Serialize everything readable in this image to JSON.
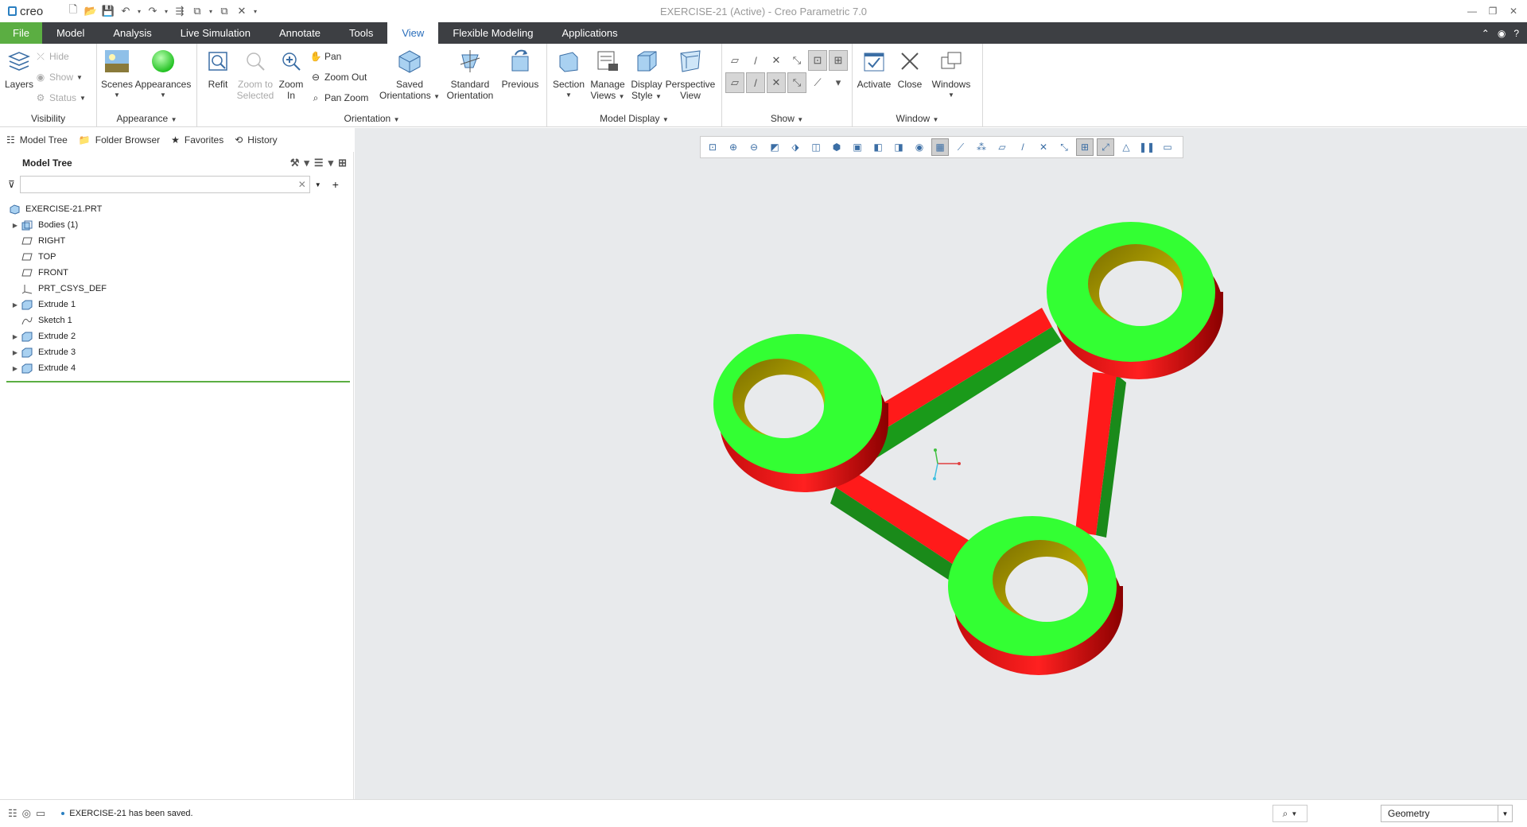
{
  "app": {
    "brand": "creo",
    "window_title": "EXERCISE-21 (Active) - Creo Parametric 7.0"
  },
  "tabs": [
    {
      "label": "File"
    },
    {
      "label": "Model"
    },
    {
      "label": "Analysis"
    },
    {
      "label": "Live Simulation"
    },
    {
      "label": "Annotate"
    },
    {
      "label": "Tools"
    },
    {
      "label": "View"
    },
    {
      "label": "Flexible Modeling"
    },
    {
      "label": "Applications"
    }
  ],
  "ribbon": {
    "visibility": {
      "label": "Visibility",
      "layers": "Layers",
      "hide": "Hide",
      "show": "Show",
      "status": "Status"
    },
    "appearance": {
      "label": "Appearance",
      "scenes": "Scenes",
      "appearances": "Appearances"
    },
    "orientation": {
      "label": "Orientation",
      "refit": "Refit",
      "zoom_to_selected_1": "Zoom to",
      "zoom_to_selected_2": "Selected",
      "zoom_in_1": "Zoom",
      "zoom_in_2": "In",
      "pan": "Pan",
      "zoom_out": "Zoom Out",
      "pan_zoom": "Pan Zoom",
      "saved_1": "Saved",
      "saved_2": "Orientations",
      "standard_1": "Standard",
      "standard_2": "Orientation",
      "previous": "Previous"
    },
    "model_display": {
      "label": "Model Display",
      "section": "Section",
      "manage_1": "Manage",
      "manage_2": "Views",
      "display_1": "Display",
      "display_2": "Style",
      "perspective_1": "Perspective",
      "perspective_2": "View"
    },
    "show": {
      "label": "Show"
    },
    "window": {
      "label": "Window",
      "activate": "Activate",
      "close": "Close",
      "windows": "Windows"
    }
  },
  "nav_tabs": [
    {
      "label": "Model Tree",
      "icon": "model-tree-icon"
    },
    {
      "label": "Folder Browser",
      "icon": "folder-icon"
    },
    {
      "label": "Favorites",
      "icon": "favorites-icon"
    },
    {
      "label": "History",
      "icon": "history-icon"
    }
  ],
  "model_tree": {
    "title": "Model Tree",
    "search_value": "",
    "items": [
      {
        "label": "EXERCISE-21.PRT",
        "icon": "part-icon",
        "expandable": false,
        "indent": 0
      },
      {
        "label": "Bodies (1)",
        "icon": "bodies-icon",
        "expandable": true,
        "indent": 1
      },
      {
        "label": "RIGHT",
        "icon": "datum-plane-icon",
        "expandable": false,
        "indent": 1
      },
      {
        "label": "TOP",
        "icon": "datum-plane-icon",
        "expandable": false,
        "indent": 1
      },
      {
        "label": "FRONT",
        "icon": "datum-plane-icon",
        "expandable": false,
        "indent": 1
      },
      {
        "label": "PRT_CSYS_DEF",
        "icon": "csys-icon",
        "expandable": false,
        "indent": 1
      },
      {
        "label": "Extrude 1",
        "icon": "extrude-icon",
        "expandable": true,
        "indent": 1
      },
      {
        "label": "Sketch 1",
        "icon": "sketch-icon",
        "expandable": false,
        "indent": 1
      },
      {
        "label": "Extrude 2",
        "icon": "extrude-icon",
        "expandable": true,
        "indent": 1
      },
      {
        "label": "Extrude 3",
        "icon": "extrude-icon",
        "expandable": true,
        "indent": 1
      },
      {
        "label": "Extrude 4",
        "icon": "extrude-icon",
        "expandable": true,
        "indent": 1
      }
    ]
  },
  "status": {
    "message": "EXERCISE-21 has been saved.",
    "filter": "Geometry"
  },
  "colors": {
    "accent": "#5bae42",
    "tabbar": "#3d3f43",
    "model_top": "#33ff33",
    "model_side": "#ee1111",
    "model_hole": "#b5a600"
  }
}
